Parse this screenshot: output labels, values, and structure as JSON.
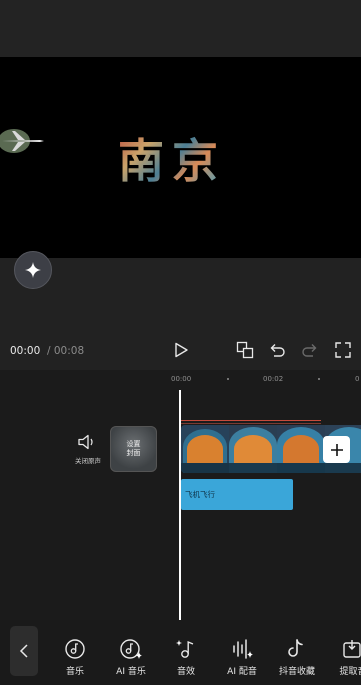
{
  "preview": {
    "title_text": "南京"
  },
  "player": {
    "current_time": "00:00",
    "total_time": " / 00:08"
  },
  "ruler": {
    "marks": [
      "00:00",
      "00:02",
      "0"
    ]
  },
  "track": {
    "mute_label": "关闭原声",
    "cover_label_line1": "设置",
    "cover_label_line2": "封面",
    "text_clip_label": "飞机飞行"
  },
  "toolbar": {
    "items": [
      {
        "label": "音乐",
        "icon": "music-icon"
      },
      {
        "label": "AI 音乐",
        "icon": "ai-music-icon"
      },
      {
        "label": "音效",
        "icon": "sound-effect-icon"
      },
      {
        "label": "AI 配音",
        "icon": "ai-voice-icon"
      },
      {
        "label": "抖音收藏",
        "icon": "douyin-favorites-icon"
      },
      {
        "label": "提取音",
        "icon": "extract-audio-icon"
      }
    ]
  },
  "colors": {
    "background": "#222222",
    "timeline": "#1b1b1b",
    "text_clip": "#3aa6d9",
    "playhead": "#ffffff"
  }
}
